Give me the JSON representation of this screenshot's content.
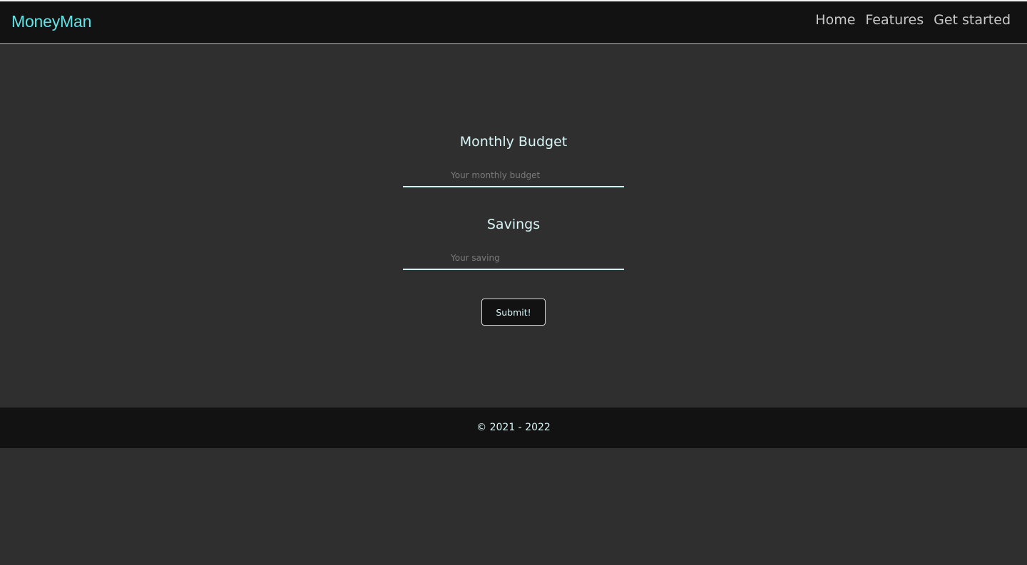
{
  "navbar": {
    "brand": "MoneyMan",
    "links": [
      "Home",
      "Features",
      "Get started"
    ]
  },
  "form": {
    "budget_label": "Monthly Budget",
    "budget_placeholder": "Your monthly budget",
    "budget_value": "",
    "savings_label": "Savings",
    "savings_placeholder": "Your saving",
    "savings_value": "",
    "submit_label": "Submit!"
  },
  "footer": {
    "copyright": "© 2021 - 2022"
  },
  "colors": {
    "accent": "#5fe3e6",
    "background": "#2f2f2f",
    "bar": "#121212",
    "text_light": "#d8f6f7"
  }
}
